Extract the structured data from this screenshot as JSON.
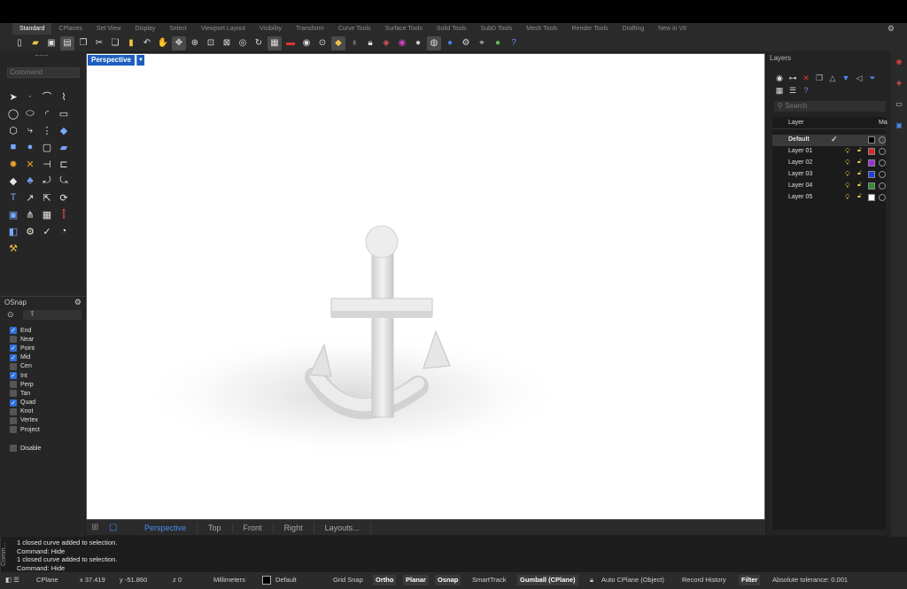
{
  "tabs": [
    "Standard",
    "CPlanes",
    "Set View",
    "Display",
    "Select",
    "Viewport Layout",
    "Visibility",
    "Transform",
    "Curve Tools",
    "Surface Tools",
    "Solid Tools",
    "SubD Tools",
    "Mesh Tools",
    "Render Tools",
    "Drafting",
    "New in V8"
  ],
  "active_tab": "Standard",
  "command": {
    "placeholder": "Command"
  },
  "viewport": {
    "title": "Perspective",
    "tabs": [
      "Perspective",
      "Top",
      "Front",
      "Right",
      "Layouts..."
    ],
    "active_tab": "Perspective"
  },
  "osnap": {
    "title": "OSnap",
    "items": [
      {
        "label": "End",
        "checked": true
      },
      {
        "label": "Near",
        "checked": false
      },
      {
        "label": "Point",
        "checked": true
      },
      {
        "label": "Mid",
        "checked": true
      },
      {
        "label": "Cen",
        "checked": false
      },
      {
        "label": "Int",
        "checked": true
      },
      {
        "label": "Perp",
        "checked": false
      },
      {
        "label": "Tan",
        "checked": false
      },
      {
        "label": "Quad",
        "checked": true
      },
      {
        "label": "Knot",
        "checked": false
      },
      {
        "label": "Vertex",
        "checked": false
      },
      {
        "label": "Project",
        "checked": false
      }
    ],
    "disable_label": "Disable"
  },
  "layers": {
    "title": "Layers",
    "search_placeholder": "Search",
    "col_layer": "Layer",
    "col_material": "Ma",
    "rows": [
      {
        "name": "Default",
        "current": true,
        "color": "#000000"
      },
      {
        "name": "Layer 01",
        "current": false,
        "color": "#d62828"
      },
      {
        "name": "Layer 02",
        "current": false,
        "color": "#9b30d9"
      },
      {
        "name": "Layer 03",
        "current": false,
        "color": "#1f3fe0"
      },
      {
        "name": "Layer 04",
        "current": false,
        "color": "#2f8f2f"
      },
      {
        "name": "Layer 05",
        "current": false,
        "color": "#ffffff"
      }
    ]
  },
  "history": [
    "1 closed curve added to selection.",
    "Command: Hide",
    "1 closed curve added to selection.",
    "Command: Hide"
  ],
  "history_side_label": "Comm...",
  "status": {
    "cplane": "CPlane",
    "x": "x 37.419",
    "y": "y -51.860",
    "z": "z 0",
    "units": "Millimeters",
    "layer": "Default",
    "grid_snap": "Grid Snap",
    "ortho": "Ortho",
    "planar": "Planar",
    "osnap": "Osnap",
    "smarttrack": "SmartTrack",
    "gumball": "Gumball (CPlane)",
    "auto_cplane": "Auto CPlane (Object)",
    "record_history": "Record History",
    "filter": "Filter",
    "tolerance": "Absolute tolerance: 0.001"
  }
}
